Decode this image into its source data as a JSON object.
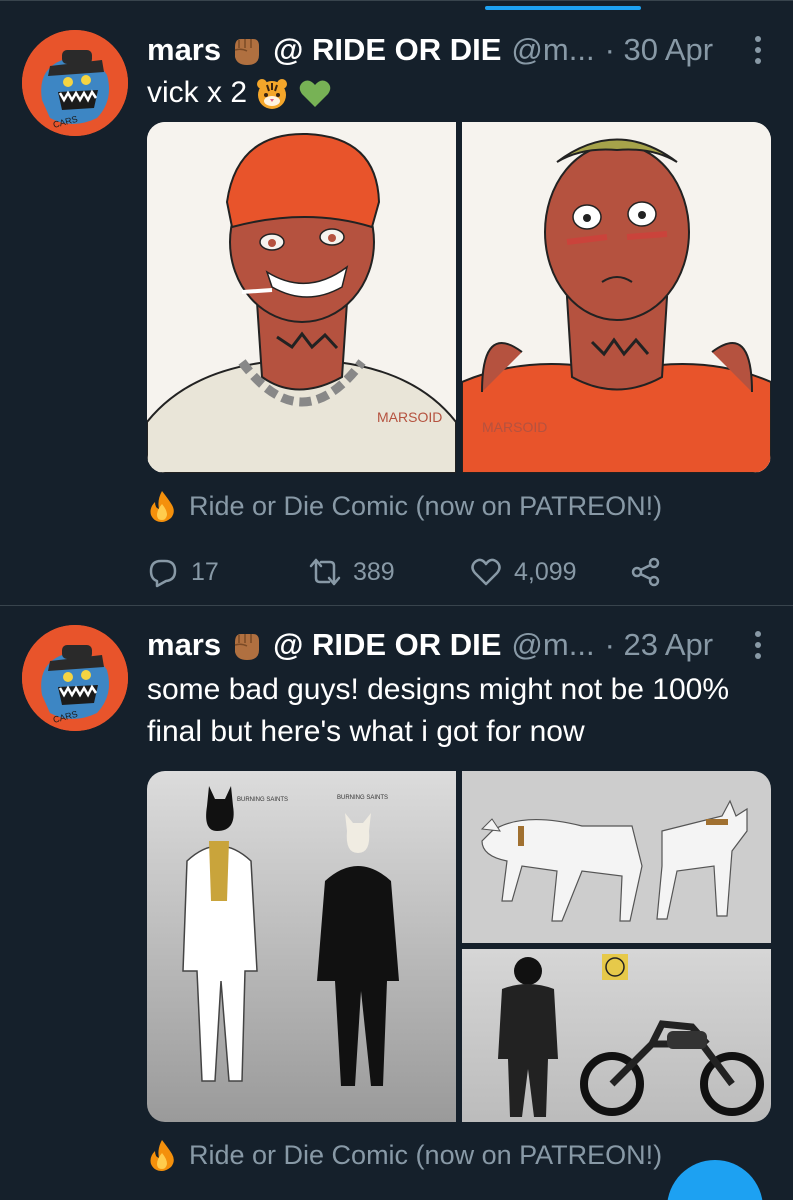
{
  "colors": {
    "background": "#15202b",
    "accent": "#1da1f2",
    "muted": "#8899a6",
    "divider": "#38444d"
  },
  "tweets": [
    {
      "name": "mars",
      "team": "@ RIDE OR DIE",
      "handle": "@m...",
      "date": "· 30 Apr",
      "text": "vick x 2",
      "emojis": [
        "tiger-face",
        "green-heart"
      ],
      "media": [
        {
          "alt": "character drawing in orange beanie and chain necklace",
          "watermark": "MARSOID"
        },
        {
          "alt": "character drawing blushing in orange tank top",
          "watermark": "MARSOID"
        }
      ],
      "source": "Ride or Die Comic (now on PATREON!)",
      "stats": {
        "replies": "17",
        "retweets": "389",
        "likes": "4,099"
      }
    },
    {
      "name": "mars",
      "team": "@ RIDE OR DIE",
      "handle": "@m...",
      "date": "· 23 Apr",
      "text": "some bad guys! designs might not be 100% final but here's what i got for now",
      "media": [
        {
          "alt": "burning saints leader and member designs"
        },
        {
          "alt": "two white wolves"
        },
        {
          "alt": "rider in black next to motorcycle"
        }
      ],
      "source": "Ride or Die Comic (now on PATREON!)"
    }
  ]
}
